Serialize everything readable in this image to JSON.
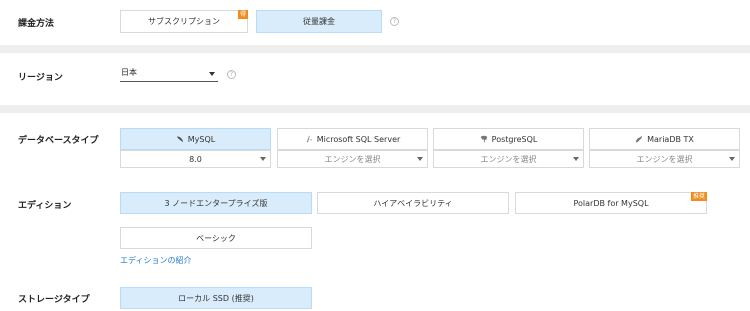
{
  "billing": {
    "label": "課金方法",
    "options": [
      {
        "text": "サブスクリプション",
        "badge": "得"
      },
      {
        "text": "従量課金"
      }
    ],
    "help": "?"
  },
  "region": {
    "label": "リージョン",
    "value": "日本",
    "help": "?"
  },
  "db_type": {
    "label": "データベースタイプ",
    "engines": [
      {
        "name": "MySQL",
        "version": "8.0",
        "icon": "mysql-dolphin-icon"
      },
      {
        "name": "Microsoft SQL Server",
        "version": "エンジンを選択",
        "icon": "sqlserver-icon"
      },
      {
        "name": "PostgreSQL",
        "version": "エンジンを選択",
        "icon": "postgresql-elephant-icon"
      },
      {
        "name": "MariaDB TX",
        "version": "エンジンを選択",
        "icon": "mariadb-seal-icon"
      }
    ]
  },
  "edition": {
    "label": "エディション",
    "options": [
      {
        "text": "3 ノードエンタープライズ版"
      },
      {
        "text": "ハイアベイラビリティ"
      },
      {
        "text": "PolarDB for MySQL",
        "badge": "推奨"
      },
      {
        "text": "ベーシック"
      }
    ],
    "link": "エディションの紹介"
  },
  "storage": {
    "label": "ストレージタイプ",
    "option": "ローカル SSD (推奨)"
  },
  "colors": {
    "selected_bg": "#d9ecfb",
    "badge": "#f08c1e",
    "link": "#1f7ad6",
    "separator": "#eeeeee"
  }
}
